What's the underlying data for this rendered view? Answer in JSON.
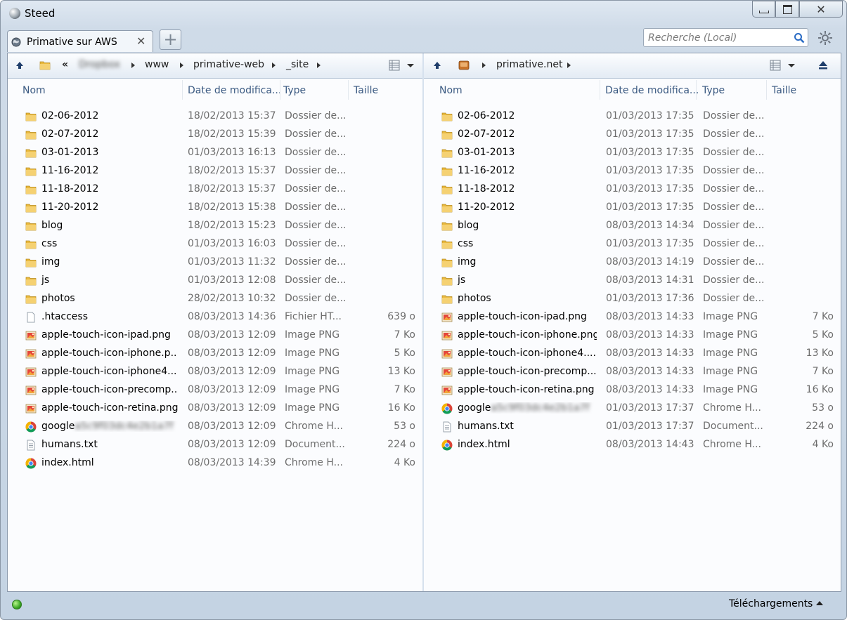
{
  "window": {
    "title": "Steed"
  },
  "tabs": [
    {
      "label": "Primative sur AWS"
    }
  ],
  "search": {
    "placeholder": "Recherche (Local)"
  },
  "left_pane": {
    "breadcrumb": [
      "«",
      "Dropbox",
      "www",
      "primative-web",
      "_site"
    ],
    "columns": {
      "name": "Nom",
      "date": "Date de modifica...",
      "type": "Type",
      "size": "Taille"
    },
    "files": [
      {
        "icon": "folder-icon",
        "name": "02-06-2012",
        "date": "18/02/2013 15:37",
        "type": "Dossier de...",
        "size": ""
      },
      {
        "icon": "folder-icon",
        "name": "02-07-2012",
        "date": "18/02/2013 15:39",
        "type": "Dossier de...",
        "size": ""
      },
      {
        "icon": "folder-icon",
        "name": "03-01-2013",
        "date": "01/03/2013 16:13",
        "type": "Dossier de...",
        "size": ""
      },
      {
        "icon": "folder-icon",
        "name": "11-16-2012",
        "date": "18/02/2013 15:37",
        "type": "Dossier de...",
        "size": ""
      },
      {
        "icon": "folder-icon",
        "name": "11-18-2012",
        "date": "18/02/2013 15:37",
        "type": "Dossier de...",
        "size": ""
      },
      {
        "icon": "folder-icon",
        "name": "11-20-2012",
        "date": "18/02/2013 15:38",
        "type": "Dossier de...",
        "size": ""
      },
      {
        "icon": "folder-icon",
        "name": "blog",
        "date": "18/02/2013 15:23",
        "type": "Dossier de...",
        "size": ""
      },
      {
        "icon": "folder-icon",
        "name": "css",
        "date": "01/03/2013 16:03",
        "type": "Dossier de...",
        "size": ""
      },
      {
        "icon": "folder-icon",
        "name": "img",
        "date": "01/03/2013 11:32",
        "type": "Dossier de...",
        "size": ""
      },
      {
        "icon": "folder-icon",
        "name": "js",
        "date": "01/03/2013 12:08",
        "type": "Dossier de...",
        "size": ""
      },
      {
        "icon": "folder-icon",
        "name": "photos",
        "date": "28/02/2013 10:32",
        "type": "Dossier de...",
        "size": ""
      },
      {
        "icon": "blank-file-icon",
        "name": ".htaccess",
        "date": "08/03/2013 14:36",
        "type": "Fichier HT...",
        "size": "639 o"
      },
      {
        "icon": "png-image-icon",
        "name": "apple-touch-icon-ipad.png",
        "date": "08/03/2013 12:09",
        "type": "Image PNG",
        "size": "7 Ko"
      },
      {
        "icon": "png-image-icon",
        "name": "apple-touch-icon-iphone.p...",
        "date": "08/03/2013 12:09",
        "type": "Image PNG",
        "size": "5 Ko"
      },
      {
        "icon": "png-image-icon",
        "name": "apple-touch-icon-iphone4....",
        "date": "08/03/2013 12:09",
        "type": "Image PNG",
        "size": "13 Ko"
      },
      {
        "icon": "png-image-icon",
        "name": "apple-touch-icon-precomp...",
        "date": "08/03/2013 12:09",
        "type": "Image PNG",
        "size": "7 Ko"
      },
      {
        "icon": "png-image-icon",
        "name": "apple-touch-icon-retina.png",
        "date": "08/03/2013 12:09",
        "type": "Image PNG",
        "size": "16 Ko"
      },
      {
        "icon": "chrome-html-icon",
        "name": "google",
        "blur": "a5c9f03dc4e2b1a7f",
        "date": "08/03/2013 12:09",
        "type": "Chrome H...",
        "size": "53 o"
      },
      {
        "icon": "text-document-icon",
        "name": "humans.txt",
        "date": "08/03/2013 12:09",
        "type": "Document...",
        "size": "224 o"
      },
      {
        "icon": "chrome-html-icon",
        "name": "index.html",
        "date": "08/03/2013 14:39",
        "type": "Chrome H...",
        "size": "4 Ko"
      }
    ]
  },
  "right_pane": {
    "breadcrumb": [
      "primative.net"
    ],
    "columns": {
      "name": "Nom",
      "date": "Date de modifica...",
      "type": "Type",
      "size": "Taille"
    },
    "files": [
      {
        "icon": "folder-icon",
        "name": "02-06-2012",
        "date": "01/03/2013 17:35",
        "type": "Dossier de...",
        "size": ""
      },
      {
        "icon": "folder-icon",
        "name": "02-07-2012",
        "date": "01/03/2013 17:35",
        "type": "Dossier de...",
        "size": ""
      },
      {
        "icon": "folder-icon",
        "name": "03-01-2013",
        "date": "01/03/2013 17:35",
        "type": "Dossier de...",
        "size": ""
      },
      {
        "icon": "folder-icon",
        "name": "11-16-2012",
        "date": "01/03/2013 17:35",
        "type": "Dossier de...",
        "size": ""
      },
      {
        "icon": "folder-icon",
        "name": "11-18-2012",
        "date": "01/03/2013 17:35",
        "type": "Dossier de...",
        "size": ""
      },
      {
        "icon": "folder-icon",
        "name": "11-20-2012",
        "date": "01/03/2013 17:35",
        "type": "Dossier de...",
        "size": ""
      },
      {
        "icon": "folder-icon",
        "name": "blog",
        "date": "08/03/2013 14:34",
        "type": "Dossier de...",
        "size": ""
      },
      {
        "icon": "folder-icon",
        "name": "css",
        "date": "01/03/2013 17:35",
        "type": "Dossier de...",
        "size": ""
      },
      {
        "icon": "folder-icon",
        "name": "img",
        "date": "08/03/2013 14:19",
        "type": "Dossier de...",
        "size": ""
      },
      {
        "icon": "folder-icon",
        "name": "js",
        "date": "08/03/2013 14:31",
        "type": "Dossier de...",
        "size": ""
      },
      {
        "icon": "folder-icon",
        "name": "photos",
        "date": "01/03/2013 17:36",
        "type": "Dossier de...",
        "size": ""
      },
      {
        "icon": "png-image-icon",
        "name": "apple-touch-icon-ipad.png",
        "date": "08/03/2013 14:33",
        "type": "Image PNG",
        "size": "7 Ko"
      },
      {
        "icon": "png-image-icon",
        "name": "apple-touch-icon-iphone.png",
        "date": "08/03/2013 14:33",
        "type": "Image PNG",
        "size": "5 Ko"
      },
      {
        "icon": "png-image-icon",
        "name": "apple-touch-icon-iphone4....",
        "date": "08/03/2013 14:33",
        "type": "Image PNG",
        "size": "13 Ko"
      },
      {
        "icon": "png-image-icon",
        "name": "apple-touch-icon-precomp...",
        "date": "08/03/2013 14:33",
        "type": "Image PNG",
        "size": "7 Ko"
      },
      {
        "icon": "png-image-icon",
        "name": "apple-touch-icon-retina.png",
        "date": "08/03/2013 14:33",
        "type": "Image PNG",
        "size": "16 Ko"
      },
      {
        "icon": "chrome-html-icon",
        "name": "google",
        "blur": "a5c9f03dc4e2b1a7f",
        "date": "01/03/2013 17:37",
        "type": "Chrome H...",
        "size": "53 o"
      },
      {
        "icon": "text-document-icon",
        "name": "humans.txt",
        "date": "01/03/2013 17:37",
        "type": "Document...",
        "size": "224 o"
      },
      {
        "icon": "chrome-html-icon",
        "name": "index.html",
        "date": "08/03/2013 14:43",
        "type": "Chrome H...",
        "size": "4 Ko"
      }
    ]
  },
  "statusbar": {
    "downloads_label": "Téléchargements",
    "connection_status_color": "#3ca825"
  },
  "colors": {
    "header_text": "#3b5a82",
    "secondary_text": "#6d6d6d",
    "window_frame": "#c4d3e3"
  }
}
